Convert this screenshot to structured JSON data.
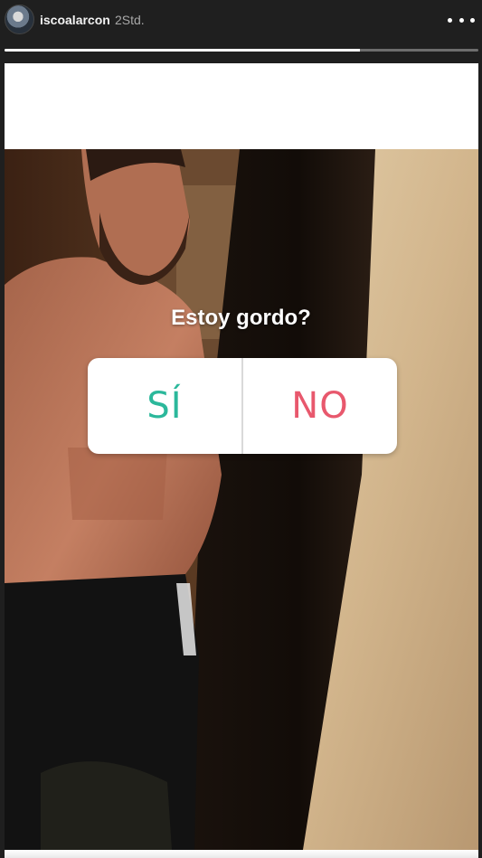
{
  "header": {
    "username": "iscoalarcon",
    "timestamp": "2Std.",
    "more_icon": "more-horizontal-icon",
    "story_progress": 0.75
  },
  "story": {
    "question": "Estoy gordo?",
    "poll": {
      "options": [
        {
          "label": "SÍ",
          "color": "#2bb89b"
        },
        {
          "label": "NO",
          "color": "#e8586d"
        }
      ]
    }
  },
  "colors": {
    "background": "#1f1f1f",
    "poll_yes": "#2bb89b",
    "poll_no": "#e8586d"
  }
}
